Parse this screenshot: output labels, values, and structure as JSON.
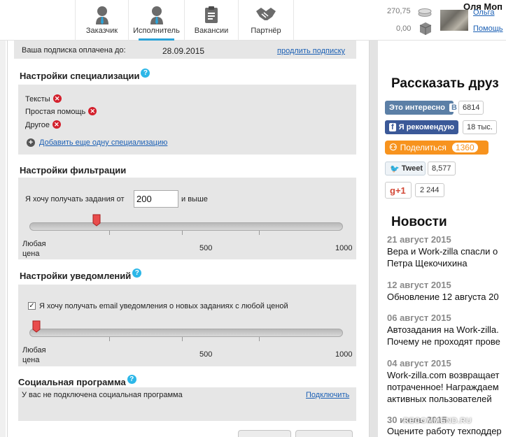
{
  "nav": {
    "tabs": [
      {
        "label": "Заказчик",
        "icon": "customer-icon"
      },
      {
        "label": "Исполнитель",
        "icon": "performer-icon"
      },
      {
        "label": "Вакансии",
        "icon": "clipboard-icon"
      },
      {
        "label": "Партнёр",
        "icon": "handshake-icon"
      }
    ],
    "active_tab": "Исполнитель",
    "accent_color": "#2ba3d8"
  },
  "account": {
    "balance_main": "270,75",
    "balance_bonus": "0,00",
    "user_name": "Оля Моп",
    "help_link": "Помощь",
    "top_link": "Ольга"
  },
  "subscription": {
    "label": "Ваша подписка оплачена до:",
    "date": "28.09.2015",
    "extend_link": "продлить подписку"
  },
  "specialization": {
    "title": "Настройки специализации",
    "items": [
      "Тексты",
      "Простая помощь",
      "Другое"
    ],
    "add_link": "Добавить еще одну специализацию"
  },
  "filter": {
    "title": "Настройки фильтрации",
    "prefix": "Я хочу получать задания от",
    "value": "200",
    "suffix": "и выше",
    "slider_min_label_1": "Любая",
    "slider_min_label_2": "цена",
    "slider_mid_label": "500",
    "slider_max_label": "1000",
    "slider_value": 200
  },
  "notifications": {
    "title": "Настройки уведомлений",
    "checkbox_label": "Я хочу получать email уведомления о новых заданиях с любой ценой",
    "checked": true,
    "slider_min_label_1": "Любая",
    "slider_min_label_2": "цена",
    "slider_mid_label": "500",
    "slider_max_label": "1000",
    "slider_value": 0
  },
  "social": {
    "title": "Социальная программа",
    "status": "У вас не подключена социальная программа",
    "connect_link": "Подключить"
  },
  "sidebar": {
    "share_title": "Рассказать друз",
    "buttons": [
      {
        "label": "Это интересно",
        "badge": "B",
        "count": "6814",
        "color": "#5b7fa6"
      },
      {
        "label": "Я рекомендую",
        "count": "18 тыс.",
        "color": "#3b5998"
      },
      {
        "label": "Поделиться",
        "count": "1360",
        "color": "#f7931e"
      },
      {
        "label": "Tweet",
        "count": "8,577"
      },
      {
        "label": "g+1",
        "count": "2 244",
        "color": "#d34836"
      }
    ],
    "news_title": "Новости",
    "news": [
      {
        "date": "21 август 2015",
        "lines": [
          "Вера и Work-zilla спасли о",
          "Петра Щекочихина"
        ]
      },
      {
        "date": "12 август 2015",
        "lines": [
          "Обновление 12 августа 20"
        ]
      },
      {
        "date": "06 август 2015",
        "lines": [
          "Автозадания на Work-zilla.",
          "Почему не проходят прове"
        ]
      },
      {
        "date": "04 август 2015",
        "lines": [
          "Work-zilla.com возвращает",
          "потраченное! Награждаем",
          "активных пользователей"
        ]
      },
      {
        "date": "30 июль 2015",
        "lines": [
          "Оцените работу техподдер"
        ]
      }
    ]
  },
  "watermark": "RECOMMEND.RU"
}
